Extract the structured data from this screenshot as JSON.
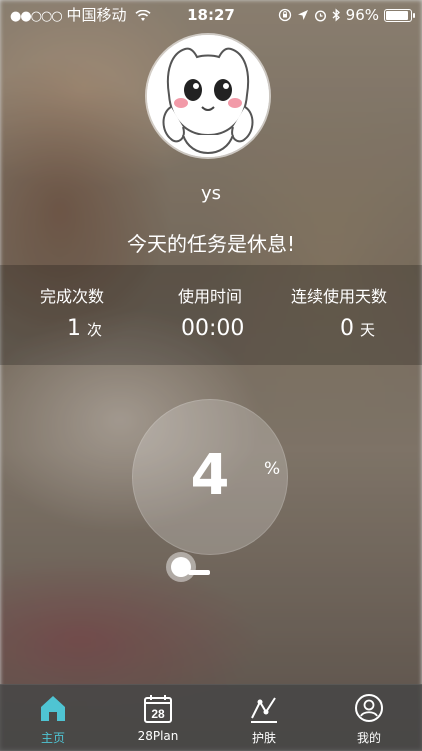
{
  "status_bar": {
    "signal": "●●○○○",
    "carrier": "中国移动",
    "time": "18:27",
    "battery": "96%"
  },
  "profile": {
    "username": "ys",
    "task_message": "今天的任务是休息!"
  },
  "stats": {
    "completions_label": "完成次数",
    "completions_value": "1",
    "completions_unit": "次",
    "usage_time_label": "使用时间",
    "usage_time_value": "00:00",
    "streak_label": "连续使用天数",
    "streak_value": "0",
    "streak_unit": "天"
  },
  "progress": {
    "value": "4",
    "unit": "%"
  },
  "tabs": [
    {
      "label": "主页",
      "icon": "home-icon",
      "active": true
    },
    {
      "label": "28Plan",
      "icon": "calendar-icon",
      "badge": "28"
    },
    {
      "label": "护肤",
      "icon": "chart-icon"
    },
    {
      "label": "我的",
      "icon": "profile-icon"
    }
  ],
  "colors": {
    "accent": "#4fc4d3"
  }
}
